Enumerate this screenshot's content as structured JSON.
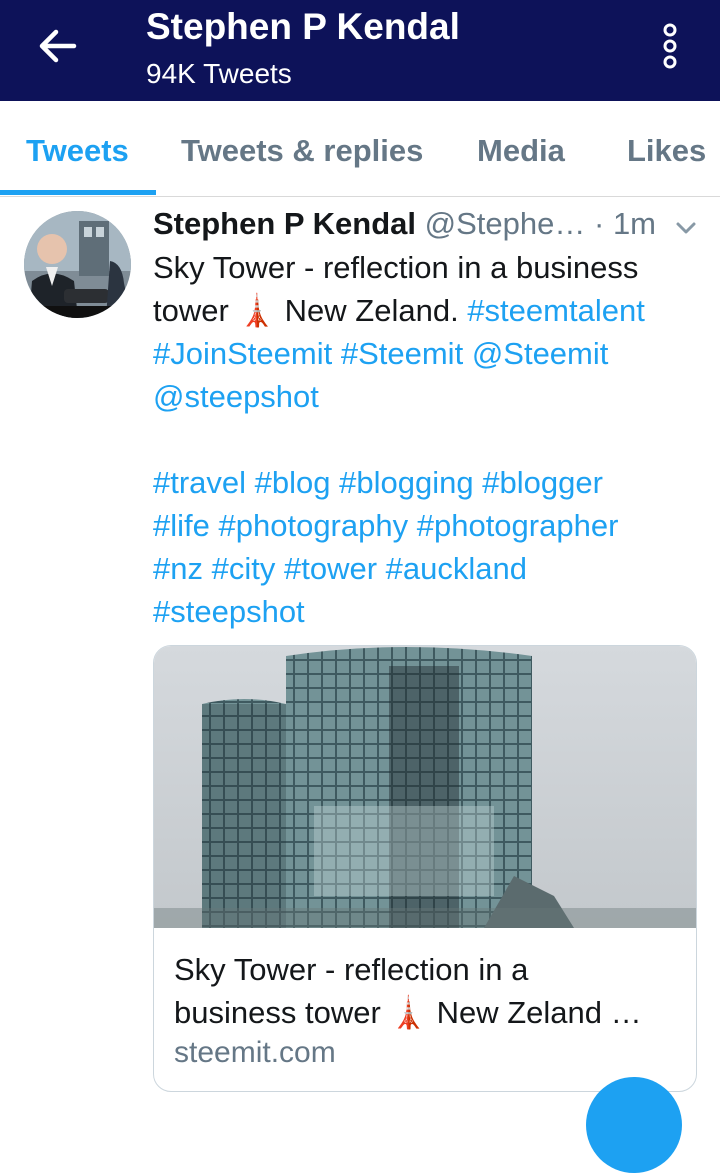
{
  "header": {
    "title": "Stephen P Kendal",
    "subtitle": "94K Tweets",
    "background": "#0d1259",
    "back_icon": "arrow-left-icon",
    "more_icon": "vertical-dots-icon"
  },
  "tabs": [
    {
      "label": "Tweets",
      "active": true
    },
    {
      "label": "Tweets & replies",
      "active": false
    },
    {
      "label": "Media",
      "active": false
    },
    {
      "label": "Likes",
      "active": false
    }
  ],
  "accent": "#1da1f2",
  "tweet": {
    "author_name": "Stephen P Kendal",
    "author_handle": "@Stephe…",
    "separator": "·",
    "time": "1m",
    "menu_icon": "chevron-down-icon",
    "text": {
      "line1": "Sky Tower - reflection in a business",
      "line2_start": "tower",
      "tower_emoji": "🗼",
      "line2_mid": " New Zeland. ",
      "line2_tag": "#steemtalent",
      "line3": [
        "#JoinSteemit",
        "#Steemit",
        "@Steemit"
      ],
      "line4": [
        "@steepshot"
      ],
      "line5": [
        "#travel",
        "#blog",
        "#blogging",
        "#blogger"
      ],
      "line6": [
        "#life",
        "#photography",
        "#photographer"
      ],
      "line7": [
        "#nz",
        "#city",
        "#tower",
        "#auckland"
      ],
      "line8": [
        "#steepshot"
      ]
    },
    "card": {
      "title_line1": "Sky Tower - reflection in a",
      "title_line2_start": "business tower ",
      "title_line2_end": " New Zeland …",
      "domain": "steemit.com"
    }
  }
}
